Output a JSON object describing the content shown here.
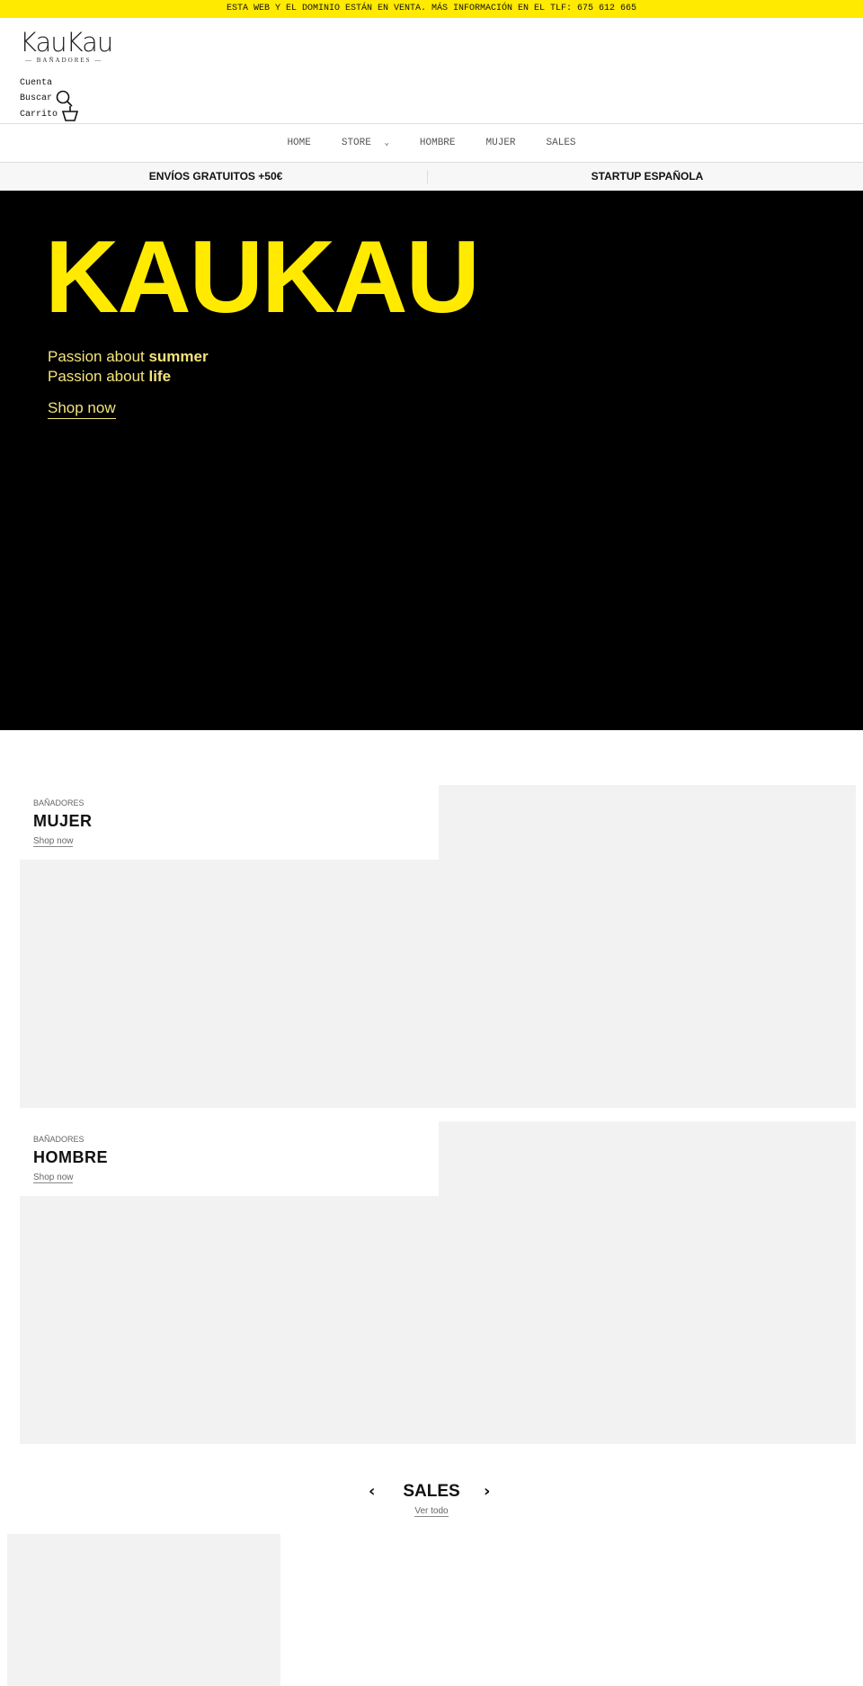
{
  "announcement": "ESTA WEB Y EL DOMINIO ESTÁN EN VENTA. MÁS INFORMACIÓN EN EL TLF: 675 612 665",
  "brand": {
    "name": "KauKau",
    "tagline": "— BAÑADORES —",
    "accent": "#ffea00"
  },
  "account": {
    "cuenta": "Cuenta",
    "buscar": "Buscar",
    "carrito": "Carrito"
  },
  "nav": [
    {
      "label": "HOME"
    },
    {
      "label": "STORE"
    },
    {
      "label": "HOMBRE"
    },
    {
      "label": "MUJER"
    },
    {
      "label": "SALES"
    }
  ],
  "info": [
    "ENVÍOS GRATUITOS +50€",
    "STARTUP ESPAÑOLA"
  ],
  "hero": {
    "title": "KAUKAU",
    "line1_a": "Passion about ",
    "line1_b": "summer",
    "line2_a": "Passion about ",
    "line2_b": "life",
    "cta": "Shop now"
  },
  "collections": [
    {
      "kicker": "BAÑADORES",
      "title": "MUJER",
      "link": "Shop now"
    },
    {
      "kicker": "BAÑADORES",
      "title": "HOMBRE",
      "link": "Shop now"
    }
  ],
  "sales": {
    "title": "SALES",
    "link": "Ver todo"
  }
}
